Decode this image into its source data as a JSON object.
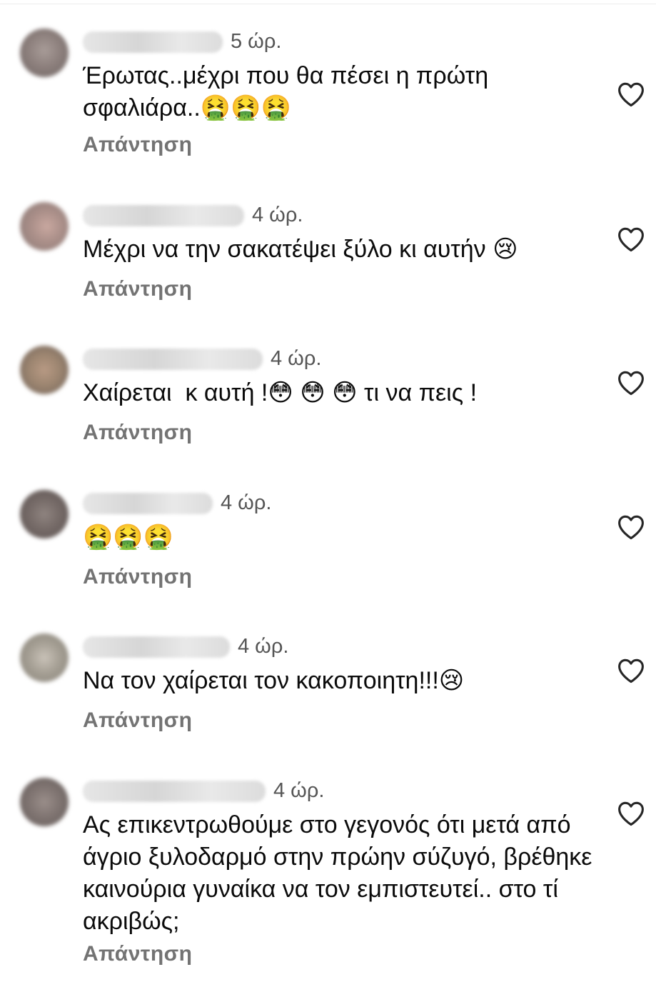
{
  "comments": [
    {
      "time": "5 ώρ.",
      "text": "Έρωτας..μέχρι που θα πέσει η πρώτη σφαλιάρα..🤮🤮🤮",
      "reply_label": "Απάντηση"
    },
    {
      "time": "4 ώρ.",
      "text": "Μέχρι να την σακατέψει ξύλο κι αυτήν 😢",
      "reply_label": "Απάντηση"
    },
    {
      "time": "4 ώρ.",
      "text": "Χαίρεται  κ αυτή !😳 😳 😳 τι να πεις !",
      "reply_label": "Απάντηση"
    },
    {
      "time": "4 ώρ.",
      "text": "🤮🤮🤮",
      "reply_label": "Απάντηση"
    },
    {
      "time": "4 ώρ.",
      "text": "Να τον χαίρεται τον κακοποιητη!!!😢",
      "reply_label": "Απάντηση"
    },
    {
      "time": "4 ώρ.",
      "text": "Ας επικεντρωθούμε στο γεγονός ότι μετά από άγριο ξυλοδαρμό στην πρώην σύζυγό, βρέθηκε καινούρια γυναίκα να τον εμπιστευτεί.. στο τί ακριβώς;",
      "reply_label": "Απάντηση"
    }
  ],
  "icons": {
    "like": "heart-outline-icon"
  },
  "colors": {
    "background": "#ffffff",
    "text": "#0b0b0b",
    "meta": "#555555",
    "reply": "#737373"
  }
}
